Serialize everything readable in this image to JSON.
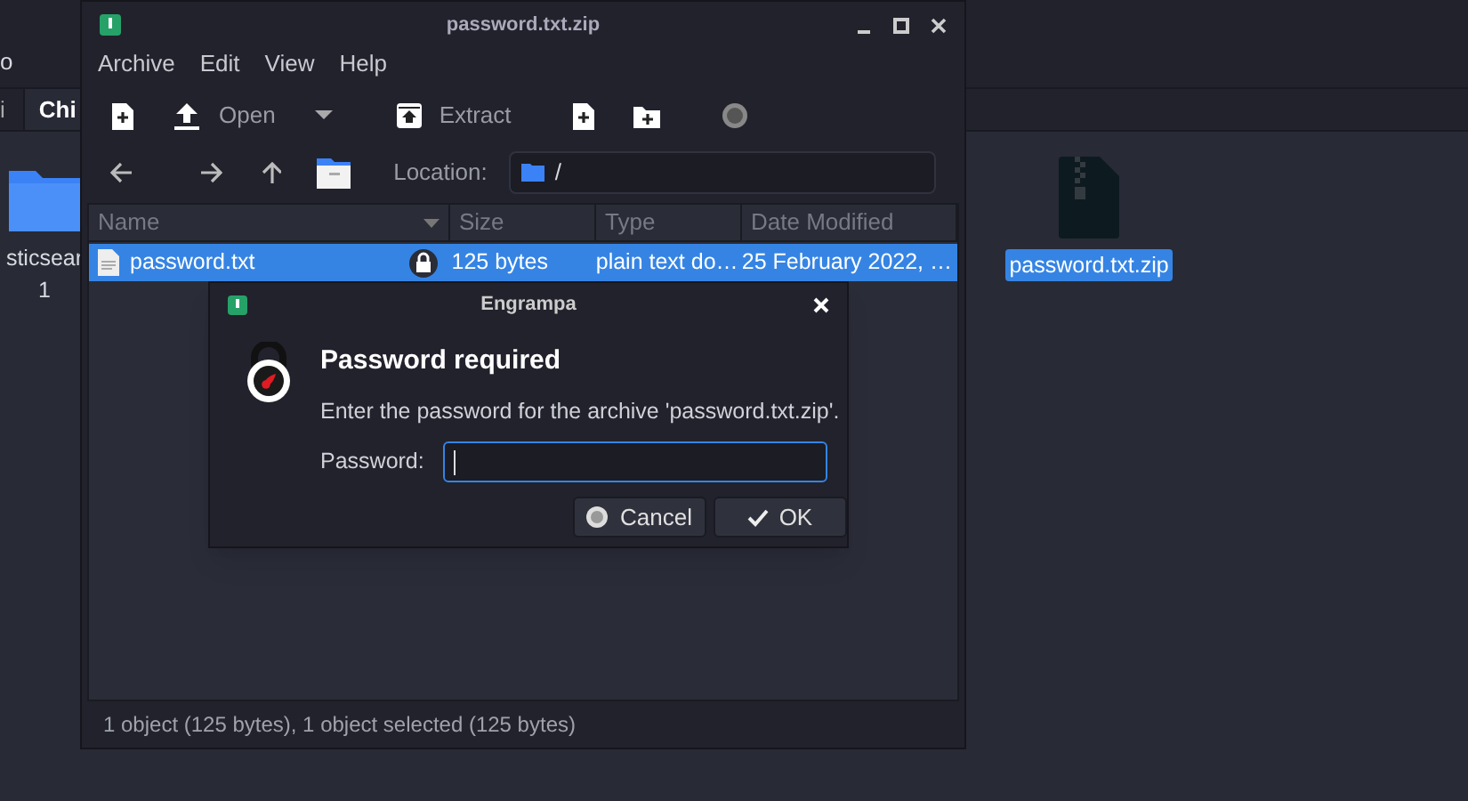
{
  "background_window": {
    "header_text": "o",
    "tabs": [
      {
        "label": "i",
        "selected": false
      },
      {
        "label": "Chi",
        "selected": true
      }
    ],
    "items": [
      {
        "kind": "folder",
        "label_lines": [
          "sticsear",
          "1"
        ],
        "selected": false
      },
      {
        "kind": "zip",
        "label_lines": [
          "password.txt.zip"
        ],
        "selected": true
      }
    ]
  },
  "archive_window": {
    "title": "password.txt.zip",
    "menu": [
      "Archive",
      "Edit",
      "View",
      "Help"
    ],
    "toolbar": [
      {
        "kind": "new"
      },
      {
        "kind": "open",
        "label": "Open"
      },
      {
        "kind": "extract",
        "label": "Extract"
      },
      {
        "kind": "add-file"
      },
      {
        "kind": "add-folder"
      },
      {
        "kind": "stop"
      }
    ],
    "location_label": "Location:",
    "location": "/",
    "table": {
      "columns": [
        "Name",
        "Size",
        "Type",
        "Date Modified"
      ],
      "rows": [
        {
          "name": "password.txt",
          "locked": true,
          "size": "125 bytes",
          "type": "plain text do…",
          "date": "25 February 2022, …",
          "selected": true
        }
      ]
    },
    "status_bar": "1 object (125 bytes), 1 object selected (125 bytes)"
  },
  "dialog": {
    "title": "Engrampa",
    "heading": "Password required",
    "message": "Enter the password for the archive 'password.txt.zip'.",
    "field_label": "Password:",
    "buttons": [
      {
        "kind": "cancel",
        "label": "Cancel"
      },
      {
        "kind": "ok",
        "label": "OK"
      }
    ]
  }
}
